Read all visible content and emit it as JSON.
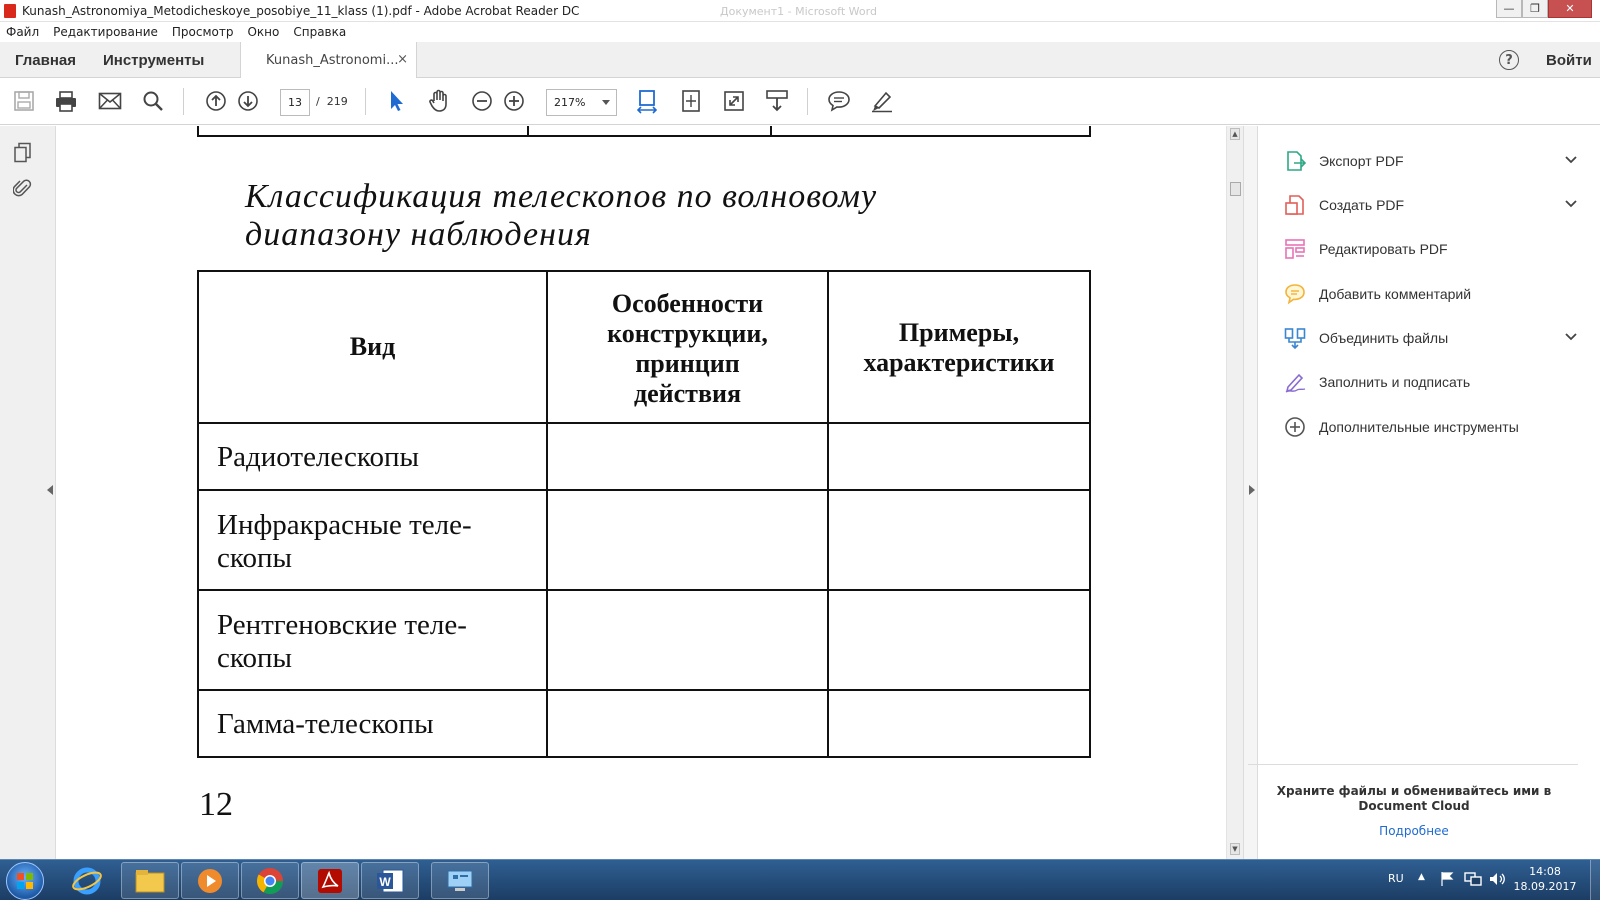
{
  "window": {
    "title": "Kunash_Astronomiya_Metodicheskoye_posobiye_11_klass (1).pdf - Adobe Acrobat Reader DC",
    "background_title": "Документ1 - Microsoft Word"
  },
  "menu": [
    "Файл",
    "Редактирование",
    "Просмотр",
    "Окно",
    "Справка"
  ],
  "tabs": {
    "home": "Главная",
    "tools": "Инструменты",
    "document": "Kunash_Astronomi...",
    "close_symbol": "×",
    "help_symbol": "?",
    "login": "Войти"
  },
  "toolbar": {
    "page_current": "13",
    "page_separator": "/",
    "page_total": "219",
    "zoom": "217%"
  },
  "document": {
    "heading_line1": "Классификация телескопов по волновому",
    "heading_line2": "диапазону наблюдения",
    "columns": [
      [
        "Вид"
      ],
      [
        "Особенности",
        "конструкции,",
        "принцип",
        "действия"
      ],
      [
        "Примеры,",
        "характеристики"
      ]
    ],
    "rows": [
      [
        "Радиотелескопы"
      ],
      [
        "Инфракрасные теле-",
        "скопы"
      ],
      [
        "Рентгеновские теле-",
        "скопы"
      ],
      [
        "Гамма-телескопы"
      ]
    ],
    "page_number": "12"
  },
  "right_panel": {
    "items": [
      {
        "label": "Экспорт PDF",
        "icon": "export-pdf-icon",
        "color": "#2da985",
        "expandable": true
      },
      {
        "label": "Создать PDF",
        "icon": "create-pdf-icon",
        "color": "#e35e59",
        "expandable": true
      },
      {
        "label": "Редактировать PDF",
        "icon": "edit-pdf-icon",
        "color": "#e873b6",
        "expandable": false
      },
      {
        "label": "Добавить комментарий",
        "icon": "comment-icon",
        "color": "#f2b33a",
        "expandable": false
      },
      {
        "label": "Объединить файлы",
        "icon": "combine-files-icon",
        "color": "#3b86d1",
        "expandable": true
      },
      {
        "label": "Заполнить и подписать",
        "icon": "fill-sign-icon",
        "color": "#8a6bd1",
        "expandable": false
      },
      {
        "label": "Дополнительные инструменты",
        "icon": "more-tools-icon",
        "color": "#555555",
        "expandable": false
      }
    ],
    "cloud_text_line1": "Храните файлы и обменивайтесь ими в",
    "cloud_text_line2": "Document Cloud",
    "more_link": "Подробнее"
  },
  "taskbar": {
    "apps": [
      "start-orb",
      "internet-explorer",
      "file-explorer",
      "media-player",
      "chrome",
      "adobe-acrobat",
      "microsoft-word",
      "control-panel"
    ],
    "language": "RU",
    "time": "14:08",
    "date": "18.09.2017"
  }
}
